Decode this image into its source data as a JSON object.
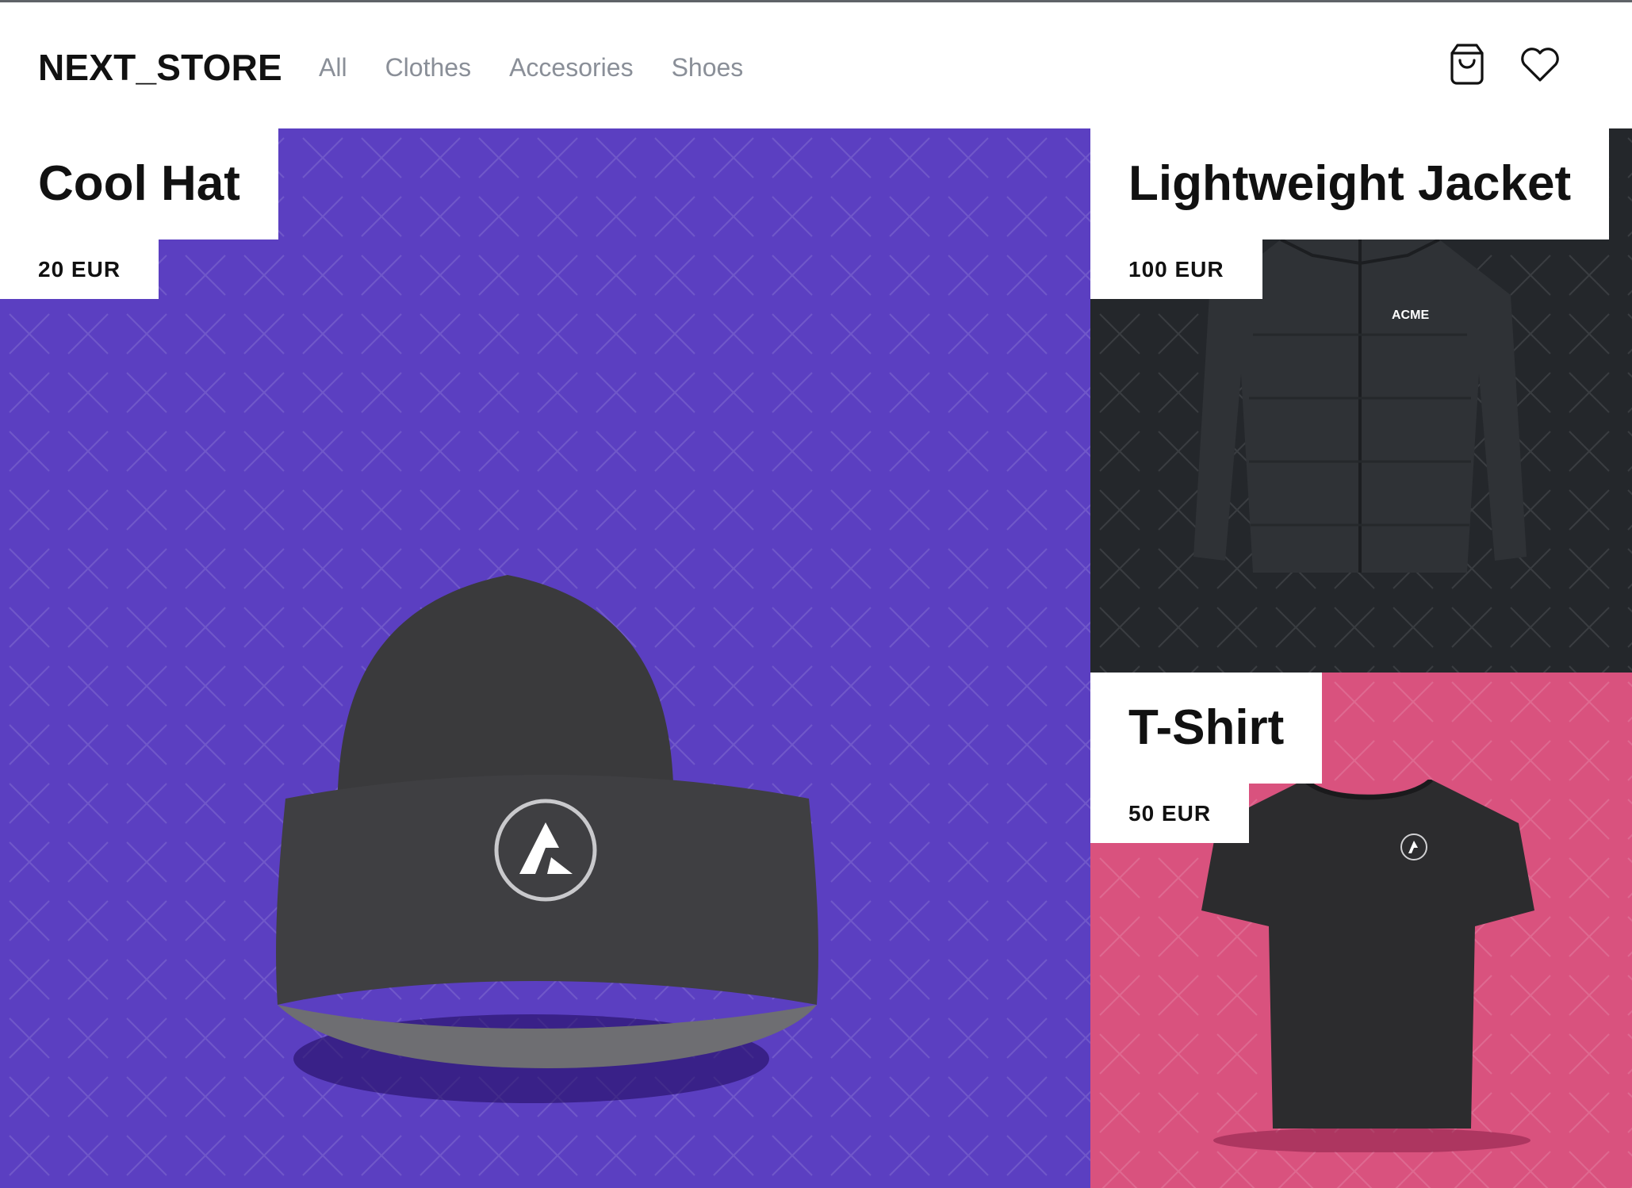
{
  "header": {
    "logo": "NEXT_STORE",
    "nav": [
      "All",
      "Clothes",
      "Accesories",
      "Shoes"
    ],
    "icons": [
      "shopping-bag-icon",
      "heart-icon"
    ]
  },
  "products": [
    {
      "title": "Cool Hat",
      "price": "20 EUR",
      "bg": "#5b3fc1"
    },
    {
      "title": "Lightweight Jacket",
      "price": "100 EUR",
      "bg": "#24272b",
      "print": "ACME"
    },
    {
      "title": "T-Shirt",
      "price": "50 EUR",
      "bg": "#d9527e"
    }
  ],
  "colors": {
    "text": "#111111",
    "nav_text": "#8a8f98",
    "hat_bg": "#5b3fc1",
    "jacket_bg": "#24272b",
    "shirt_bg": "#d9527e"
  }
}
